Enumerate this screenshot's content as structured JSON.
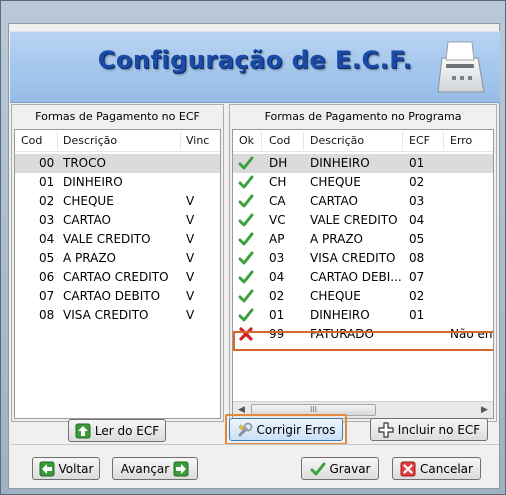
{
  "banner": {
    "title": "Configuração de E.C.F.",
    "icon": "printer-icon"
  },
  "left_panel": {
    "caption": "Formas de Pagamento no ECF",
    "columns": [
      "Cod",
      "Descrição",
      "Vinc"
    ],
    "rows": [
      {
        "cod": "00",
        "desc": "TROCO",
        "vinc": ""
      },
      {
        "cod": "01",
        "desc": "DINHEIRO",
        "vinc": ""
      },
      {
        "cod": "02",
        "desc": "CHEQUE",
        "vinc": "V"
      },
      {
        "cod": "03",
        "desc": "CARTAO",
        "vinc": "V"
      },
      {
        "cod": "04",
        "desc": "VALE CREDITO",
        "vinc": "V"
      },
      {
        "cod": "05",
        "desc": "A PRAZO",
        "vinc": "V"
      },
      {
        "cod": "06",
        "desc": "CARTAO CREDITO",
        "vinc": "V"
      },
      {
        "cod": "07",
        "desc": "CARTAO DEBITO",
        "vinc": "V"
      },
      {
        "cod": "08",
        "desc": "VISA CREDITO",
        "vinc": "V"
      }
    ],
    "read_button": "Ler do ECF"
  },
  "right_panel": {
    "caption": "Formas de Pagamento no Programa",
    "columns": [
      "Ok",
      "Cod",
      "Descrição",
      "ECF",
      "Erro"
    ],
    "rows": [
      {
        "ok": "check",
        "cod": "DH",
        "desc": "DINHEIRO",
        "ecf": "01",
        "erro": ""
      },
      {
        "ok": "check",
        "cod": "CH",
        "desc": "CHEQUE",
        "ecf": "02",
        "erro": ""
      },
      {
        "ok": "check",
        "cod": "CA",
        "desc": "CARTAO",
        "ecf": "03",
        "erro": ""
      },
      {
        "ok": "check",
        "cod": "VC",
        "desc": "VALE CREDITO",
        "ecf": "04",
        "erro": ""
      },
      {
        "ok": "check",
        "cod": "AP",
        "desc": "A PRAZO",
        "ecf": "05",
        "erro": ""
      },
      {
        "ok": "check",
        "cod": "03",
        "desc": "VISA CREDITO",
        "ecf": "08",
        "erro": ""
      },
      {
        "ok": "check",
        "cod": "04",
        "desc": "CARTAO DEBI...",
        "ecf": "07",
        "erro": ""
      },
      {
        "ok": "check",
        "cod": "02",
        "desc": "CHEQUE",
        "ecf": "02",
        "erro": ""
      },
      {
        "ok": "check",
        "cod": "01",
        "desc": "DINHEIRO",
        "ecf": "01",
        "erro": ""
      },
      {
        "ok": "error",
        "cod": "99",
        "desc": "FATURADO",
        "ecf": "",
        "erro": "Não enc"
      }
    ],
    "scrollbar_thumb": "III",
    "fix_button": "Corrigir Erros",
    "include_button": "Incluir no ECF"
  },
  "footer": {
    "back_button": "Voltar",
    "next_button": "Avançar",
    "save_button": "Gravar",
    "cancel_button": "Cancelar"
  },
  "colors": {
    "title_blue": "#1a4aa6",
    "check_green": "#3aa23a",
    "error_red": "#d0202a",
    "highlight_orange": "#d9672a"
  }
}
